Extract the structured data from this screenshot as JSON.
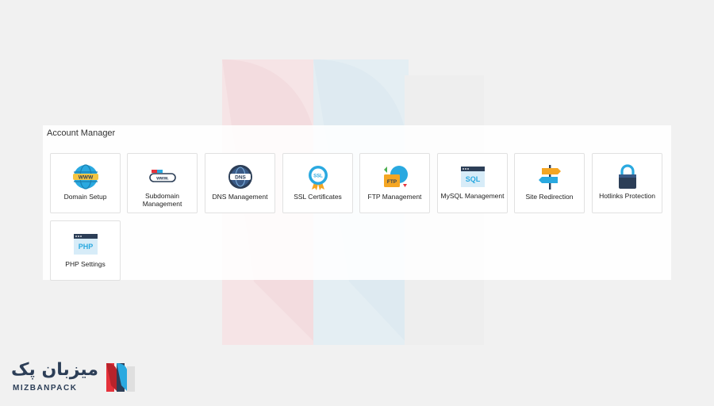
{
  "panel": {
    "title": "Account Manager"
  },
  "tiles": [
    {
      "label": "Domain Setup",
      "icon": "globe-www-icon"
    },
    {
      "label": "Subdomain Management",
      "icon": "subdomain-bar-icon"
    },
    {
      "label": "DNS Management",
      "icon": "dns-globe-icon"
    },
    {
      "label": "SSL Certificates",
      "icon": "ssl-badge-icon"
    },
    {
      "label": "FTP Management",
      "icon": "ftp-folder-icon"
    },
    {
      "label": "MySQL Management",
      "icon": "mysql-window-icon"
    },
    {
      "label": "Site Redirection",
      "icon": "signpost-icon"
    },
    {
      "label": "Hotlinks Protection",
      "icon": "padlock-icon"
    },
    {
      "label": "PHP Settings",
      "icon": "php-window-icon"
    }
  ],
  "brand": {
    "name_fa": "میزبان پک",
    "name_en": "MIZBANPACK"
  },
  "colors": {
    "accent_red": "#e5323b",
    "accent_blue": "#2aa9e0",
    "navy": "#2c3e57"
  }
}
